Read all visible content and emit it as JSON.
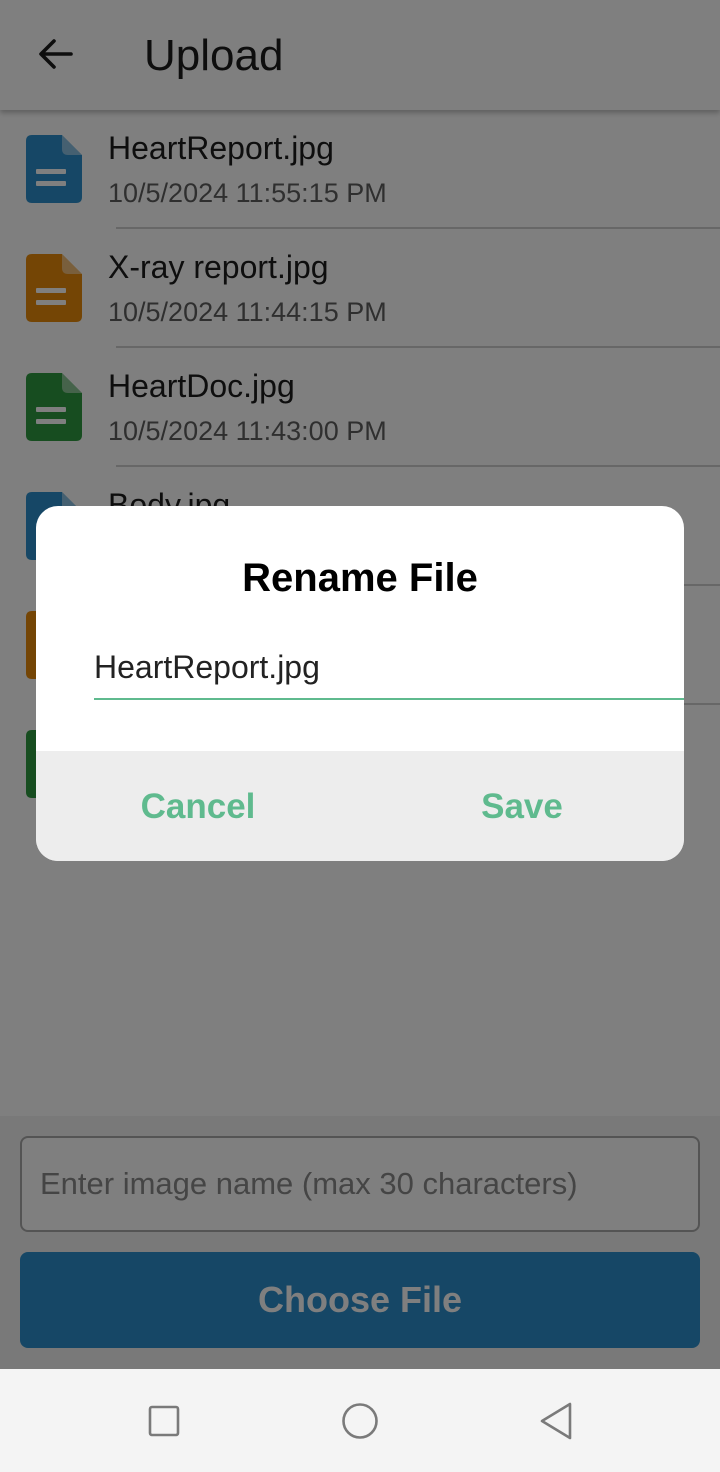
{
  "header": {
    "title": "Upload",
    "back_icon": "arrow-left-icon"
  },
  "files": [
    {
      "name": "HeartReport.jpg",
      "time": "10/5/2024 11:55:15 PM",
      "icon_color": "#2d8fcc"
    },
    {
      "name": "X-ray report.jpg",
      "time": "10/5/2024 11:44:15 PM",
      "icon_color": "#e98a0b"
    },
    {
      "name": "HeartDoc.jpg",
      "time": "10/5/2024 11:43:00 PM",
      "icon_color": "#2f9a40"
    },
    {
      "name": "Body.jpg",
      "time": "",
      "icon_color": "#2d8fcc"
    },
    {
      "name": "",
      "time": "",
      "icon_color": "#e98a0b"
    },
    {
      "name": "",
      "time": "",
      "icon_color": "#2f9a40"
    }
  ],
  "bottom": {
    "input_placeholder": "Enter image name (max 30 characters)",
    "choose_label": "Choose File",
    "choose_color": "#2d8fcc"
  },
  "dialog": {
    "title": "Rename File",
    "input_value": "HeartReport.jpg",
    "cancel_label": "Cancel",
    "save_label": "Save",
    "accent_color": "#5fba8e"
  },
  "nav": {
    "recent_icon": "square-icon",
    "home_icon": "circle-icon",
    "back_icon": "triangle-back-icon"
  }
}
